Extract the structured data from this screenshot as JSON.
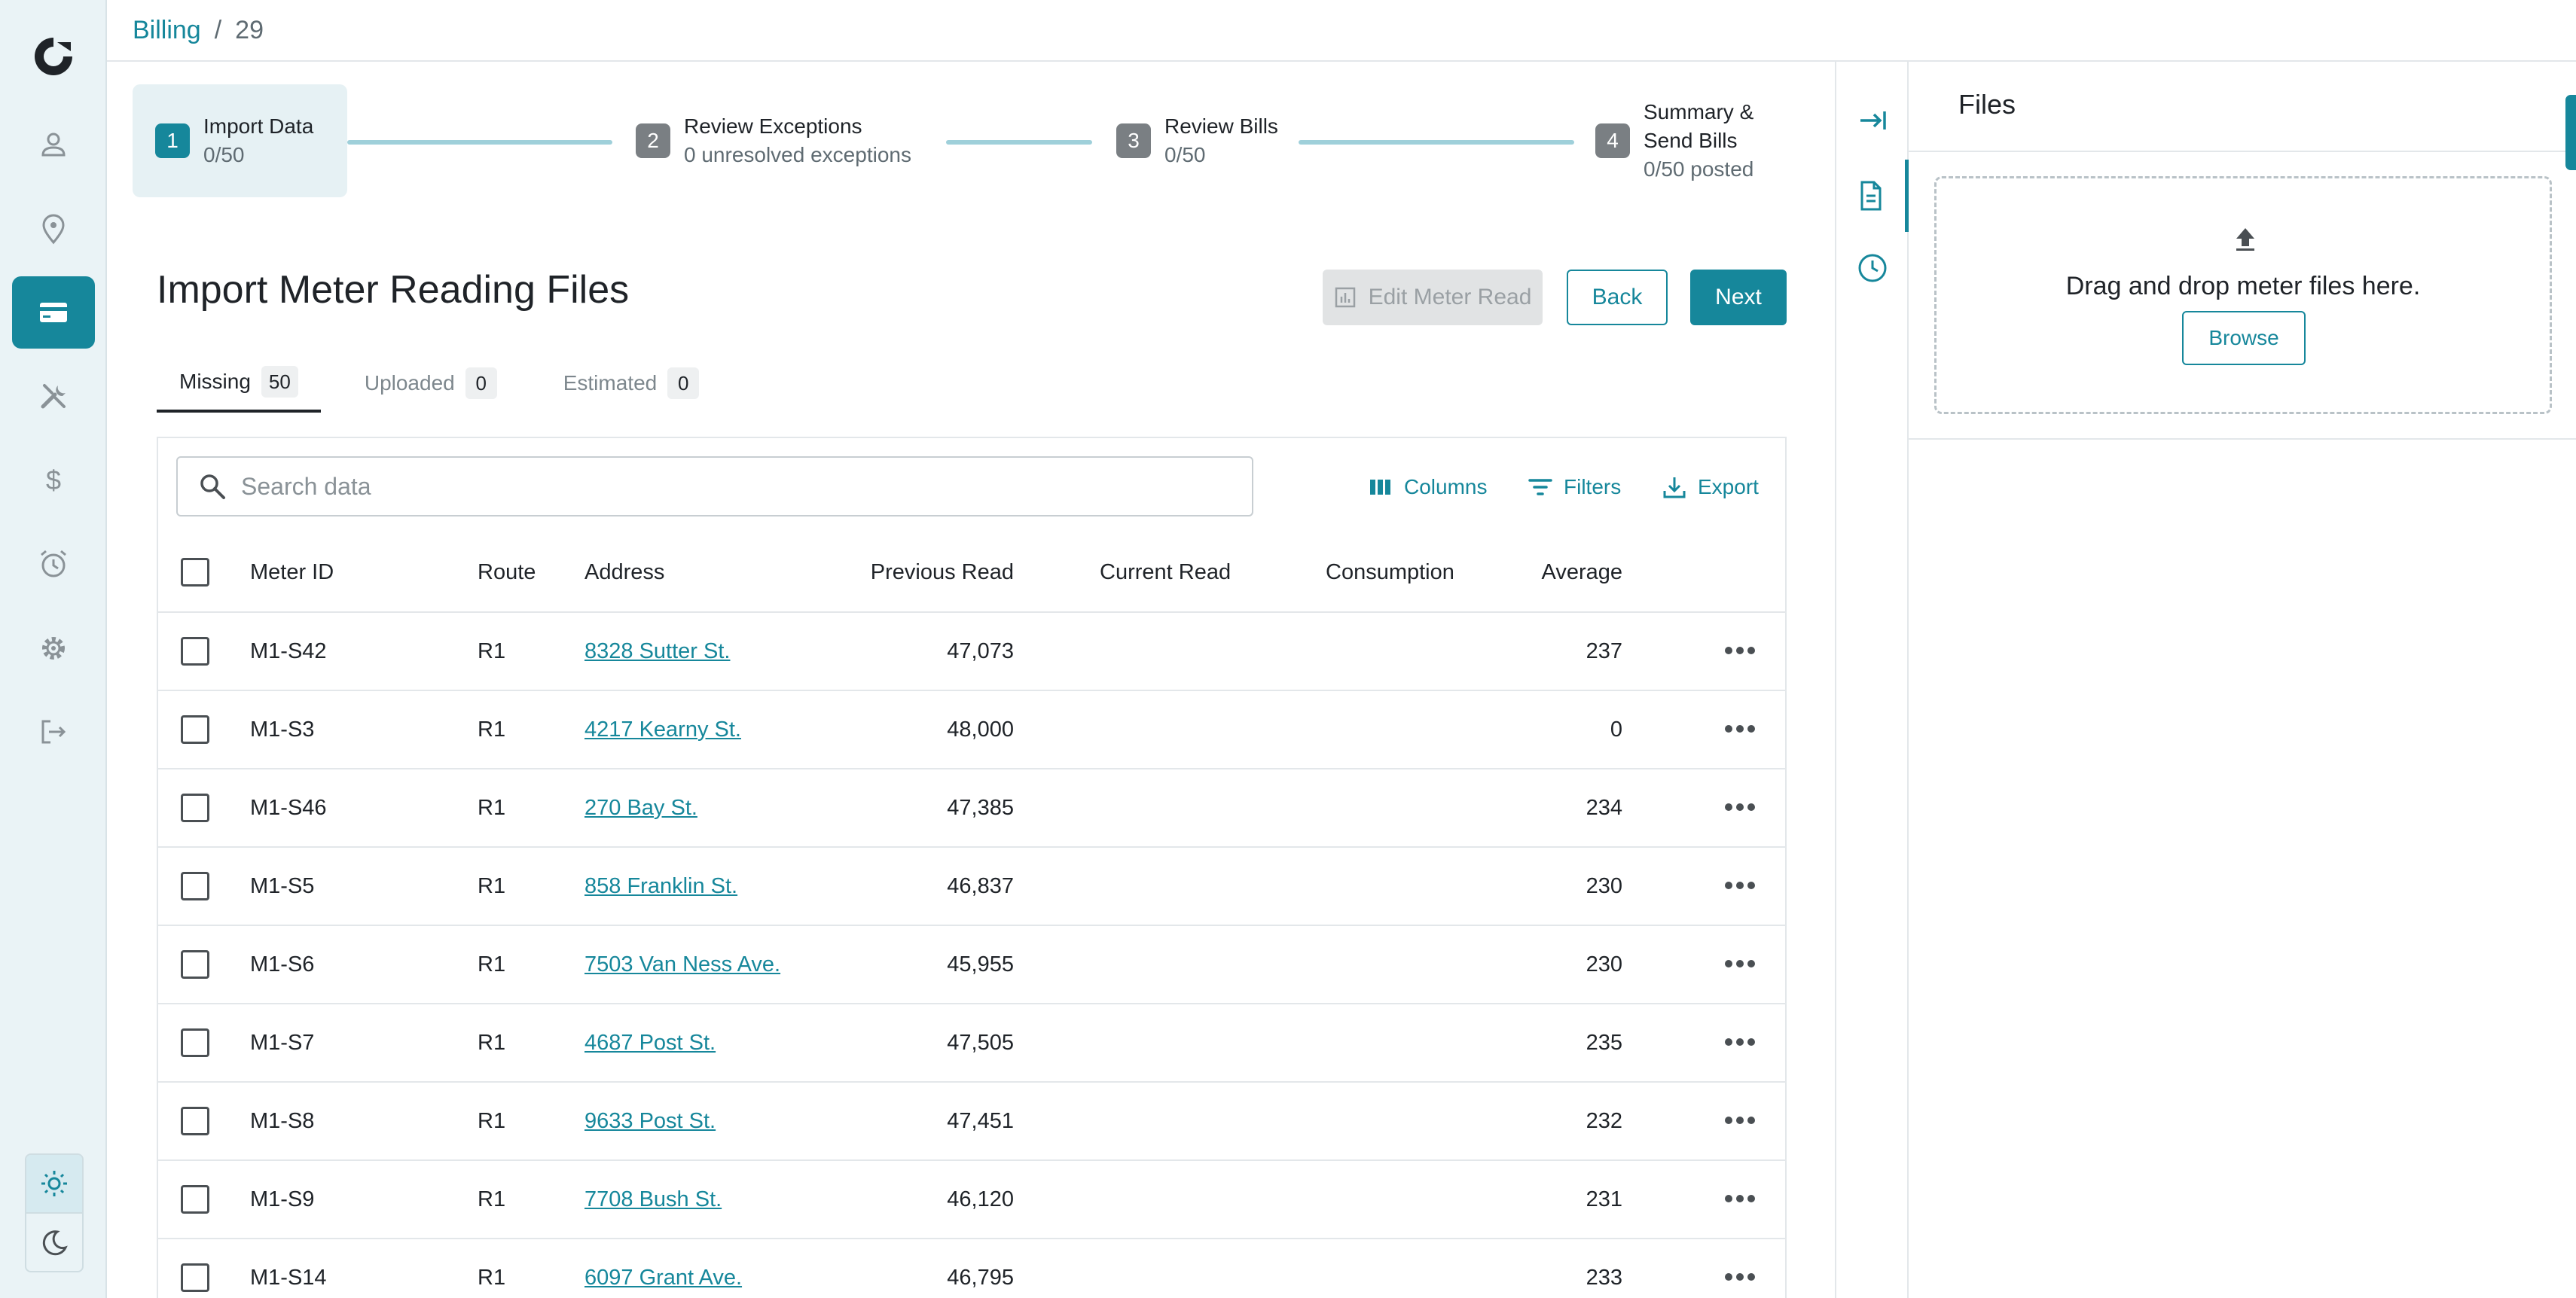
{
  "colors": {
    "accent": "#16879b",
    "nav_bg": "#eaf3f6",
    "disabled_bg": "#e1e3e4"
  },
  "nav": {
    "items": [
      {
        "icon": "person-icon",
        "active": false
      },
      {
        "icon": "location-pin-icon",
        "active": false
      },
      {
        "icon": "credit-card-icon",
        "active": true
      },
      {
        "icon": "tools-icon",
        "active": false
      },
      {
        "icon": "dollar-icon",
        "active": false
      },
      {
        "icon": "alarm-clock-icon",
        "active": false
      },
      {
        "icon": "gear-icon",
        "active": false
      },
      {
        "icon": "logout-icon",
        "active": false
      }
    ],
    "theme": {
      "selected": "light"
    }
  },
  "breadcrumb": {
    "parent": "Billing",
    "separator": "/",
    "current": "29"
  },
  "stepper": {
    "steps": [
      {
        "number": "1",
        "title": "Import Data",
        "subtitle": "0/50",
        "active": true
      },
      {
        "number": "2",
        "title": "Review Exceptions",
        "subtitle": "0 unresolved exceptions",
        "active": false
      },
      {
        "number": "3",
        "title": "Review Bills",
        "subtitle": "0/50",
        "active": false
      },
      {
        "number": "4",
        "title": "Summary &",
        "title2": "Send Bills",
        "subtitle": "0/50 posted",
        "active": false
      }
    ]
  },
  "header": {
    "title": "Import Meter Reading Files",
    "edit_label": "Edit Meter Read",
    "back_label": "Back",
    "next_label": "Next"
  },
  "tabs": [
    {
      "label": "Missing",
      "count": "50",
      "active": true
    },
    {
      "label": "Uploaded",
      "count": "0",
      "active": false
    },
    {
      "label": "Estimated",
      "count": "0",
      "active": false
    }
  ],
  "toolbar": {
    "search_placeholder": "Search data",
    "columns_label": "Columns",
    "filters_label": "Filters",
    "export_label": "Export"
  },
  "table": {
    "columns": {
      "meter_id": "Meter ID",
      "route": "Route",
      "address": "Address",
      "previous_read": "Previous Read",
      "current_read": "Current Read",
      "consumption": "Consumption",
      "average": "Average"
    },
    "rows": [
      {
        "meter_id": "M1-S42",
        "route": "R1",
        "address": "8328 Sutter St.",
        "previous_read": "47,073",
        "current_read": "",
        "consumption": "",
        "average": "237"
      },
      {
        "meter_id": "M1-S3",
        "route": "R1",
        "address": "4217 Kearny St.",
        "previous_read": "48,000",
        "current_read": "",
        "consumption": "",
        "average": "0"
      },
      {
        "meter_id": "M1-S46",
        "route": "R1",
        "address": "270 Bay St.",
        "previous_read": "47,385",
        "current_read": "",
        "consumption": "",
        "average": "234"
      },
      {
        "meter_id": "M1-S5",
        "route": "R1",
        "address": "858 Franklin St.",
        "previous_read": "46,837",
        "current_read": "",
        "consumption": "",
        "average": "230"
      },
      {
        "meter_id": "M1-S6",
        "route": "R1",
        "address": "7503 Van Ness Ave.",
        "previous_read": "45,955",
        "current_read": "",
        "consumption": "",
        "average": "230"
      },
      {
        "meter_id": "M1-S7",
        "route": "R1",
        "address": "4687 Post St.",
        "previous_read": "47,505",
        "current_read": "",
        "consumption": "",
        "average": "235"
      },
      {
        "meter_id": "M1-S8",
        "route": "R1",
        "address": "9633 Post St.",
        "previous_read": "47,451",
        "current_read": "",
        "consumption": "",
        "average": "232"
      },
      {
        "meter_id": "M1-S9",
        "route": "R1",
        "address": "7708 Bush St.",
        "previous_read": "46,120",
        "current_read": "",
        "consumption": "",
        "average": "231"
      },
      {
        "meter_id": "M1-S14",
        "route": "R1",
        "address": "6097 Grant Ave.",
        "previous_read": "46,795",
        "current_read": "",
        "consumption": "",
        "average": "233"
      }
    ]
  },
  "files_panel": {
    "title": "Files",
    "drop_text": "Drag and drop meter files here.",
    "browse_label": "Browse"
  }
}
